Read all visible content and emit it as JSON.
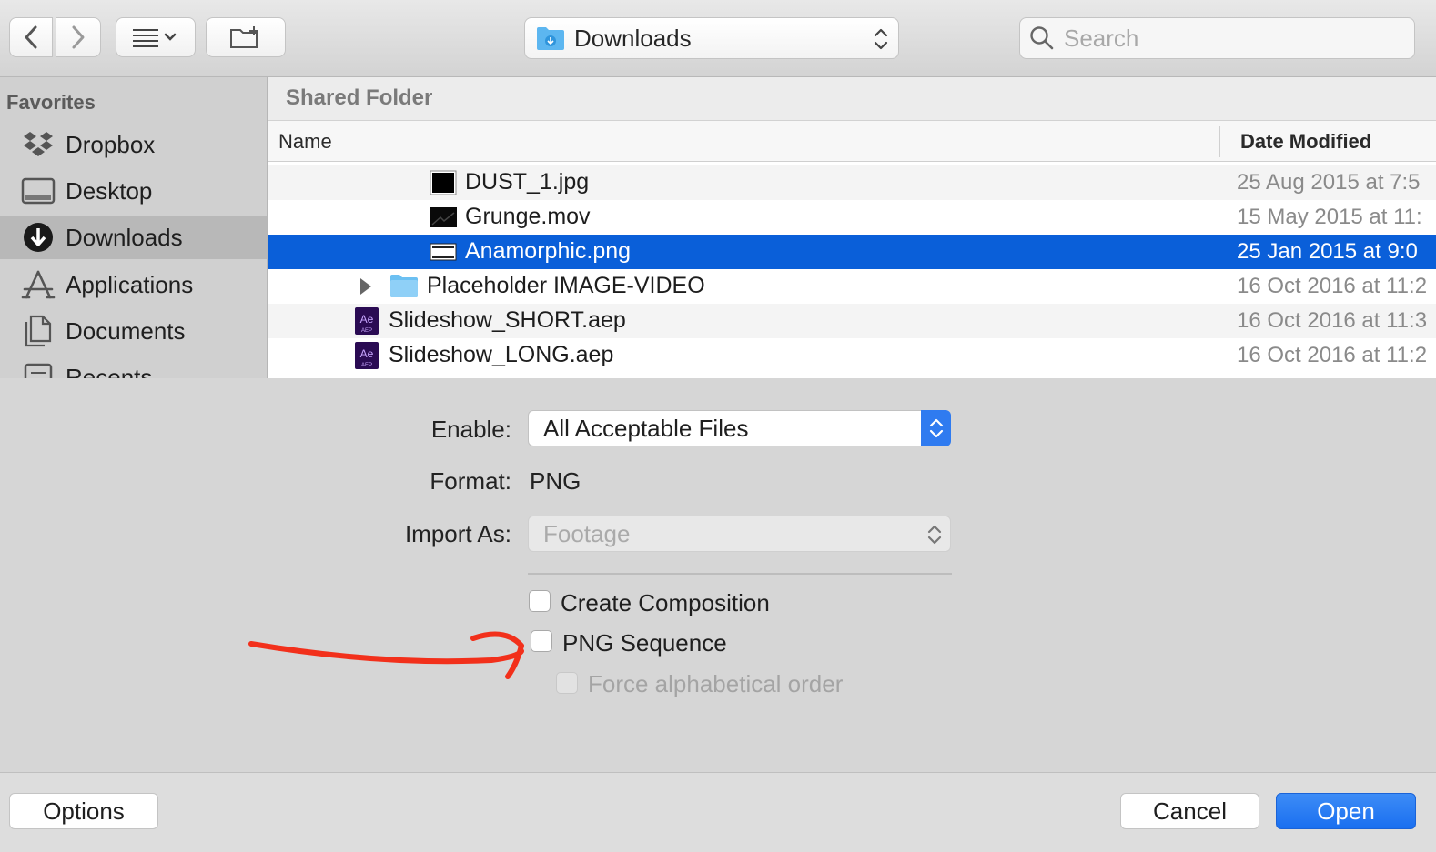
{
  "toolbar": {
    "location": "Downloads",
    "search_placeholder": "Search"
  },
  "sidebar": {
    "section_title": "Favorites",
    "items": [
      {
        "label": "Dropbox"
      },
      {
        "label": "Desktop"
      },
      {
        "label": "Downloads",
        "selected": true
      },
      {
        "label": "Applications"
      },
      {
        "label": "Documents"
      },
      {
        "label": "Recents"
      }
    ]
  },
  "browser": {
    "folder_title": "Shared Folder",
    "columns": {
      "name": "Name",
      "date": "Date Modified"
    },
    "rows": [
      {
        "name": "DUST_1.jpg",
        "date": "25 Aug 2015 at 7:5"
      },
      {
        "name": "Grunge.mov",
        "date": "15 May 2015 at 11:"
      },
      {
        "name": "Anamorphic.png",
        "date": "25 Jan 2015 at 9:0",
        "selected": true
      },
      {
        "name": "Placeholder IMAGE-VIDEO",
        "date": "16 Oct 2016 at 11:2"
      },
      {
        "name": "Slideshow_SHORT.aep",
        "date": "16 Oct 2016 at 11:3"
      },
      {
        "name": "Slideshow_LONG.aep",
        "date": "16 Oct 2016 at 11:2"
      }
    ]
  },
  "options": {
    "enable_label": "Enable:",
    "enable_value": "All Acceptable Files",
    "format_label": "Format:",
    "format_value": "PNG",
    "import_as_label": "Import As:",
    "import_as_value": "Footage",
    "create_composition": "Create Composition",
    "png_sequence": "PNG Sequence",
    "force_alpha": "Force alphabetical order"
  },
  "buttons": {
    "options": "Options",
    "cancel": "Cancel",
    "open": "Open"
  },
  "colors": {
    "accent": "#0a5fd9",
    "annotation": "#f2301b"
  }
}
